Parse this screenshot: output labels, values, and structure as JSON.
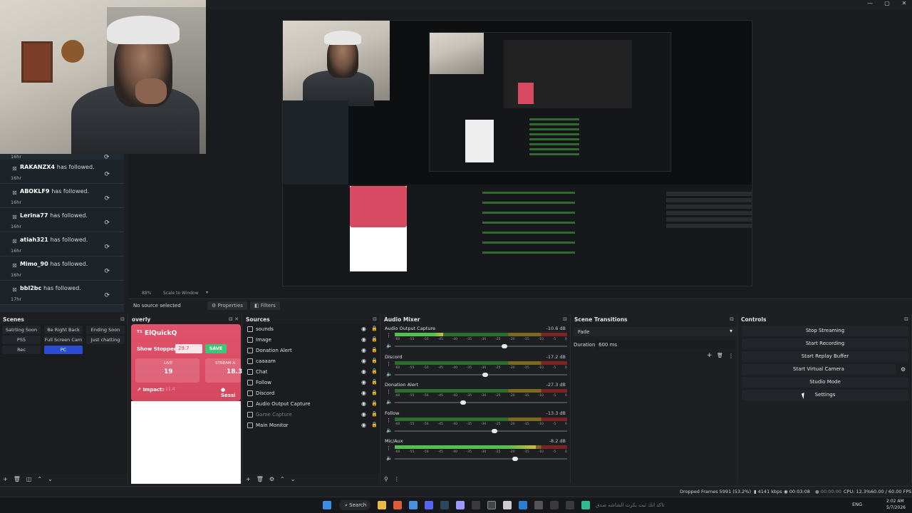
{
  "window": {
    "minimize": "—",
    "maximize": "▢",
    "close": "✕"
  },
  "chat": {
    "top_time": "16hr",
    "items": [
      {
        "name": "RAKANZX4",
        "text": "has followed.",
        "time": "16hr"
      },
      {
        "name": "ABOKLF9",
        "text": "has followed.",
        "time": "16hr"
      },
      {
        "name": "Lerina77",
        "text": "has followed.",
        "time": "16hr"
      },
      {
        "name": "atiah321",
        "text": "has followed.",
        "time": "16hr"
      },
      {
        "name": "Mimo_90",
        "text": "has followed.",
        "time": "16hr"
      },
      {
        "name": "bbl2bc",
        "text": "has followed.",
        "time": "17hr"
      }
    ]
  },
  "preview_toolbar": {
    "zoom": "88%",
    "scale_mode": "Scale to Window"
  },
  "source_bar": {
    "status": "No source selected",
    "properties": "Properties",
    "filters": "Filters"
  },
  "docks": {
    "scenes": {
      "title": "Scenes",
      "items": [
        "Satrting Soon",
        "Be Right Back",
        "Ending Soon",
        "PS5",
        "Full Screen Cam",
        "Just chatting",
        "Rec",
        "PC"
      ],
      "active": "PC"
    },
    "overly": {
      "title": "overly",
      "brand": "ElQuickQ",
      "show_stopper_label": "Show Stopper:",
      "show_stopper_value": "29.7",
      "save": "SAVE",
      "live_label": "LIVE",
      "live_value": "19",
      "stream_label": "STREAM A",
      "stream_value": "18.3",
      "impact_label": "Impact:",
      "impact_value": "-11.4",
      "session_label": "Sessi"
    },
    "sources": {
      "title": "Sources",
      "items": [
        {
          "name": "sounds",
          "dim": false
        },
        {
          "name": "Image",
          "dim": false
        },
        {
          "name": "Donation Alert",
          "dim": false
        },
        {
          "name": "caaaam",
          "dim": false
        },
        {
          "name": "Chat",
          "dim": false
        },
        {
          "name": "Follow",
          "dim": false
        },
        {
          "name": "Discord",
          "dim": false
        },
        {
          "name": "Audio Output Capture",
          "dim": false
        },
        {
          "name": "Game Capture",
          "dim": true
        },
        {
          "name": "Main Monitor",
          "dim": false
        }
      ]
    },
    "mixer": {
      "title": "Audio Mixer",
      "ticks": [
        "-60",
        "-55",
        "-50",
        "-45",
        "-40",
        "-35",
        "-30",
        "-25",
        "-20",
        "-15",
        "-10",
        "-5",
        "0"
      ],
      "channels": [
        {
          "name": "Audio Output Capture",
          "db": "-10.6 dB",
          "level": 0.28,
          "fader": 0.62
        },
        {
          "name": "Discord",
          "db": "-17.2 dB",
          "level": 0.0,
          "fader": 0.51
        },
        {
          "name": "Donation Alert",
          "db": "-27.3 dB",
          "level": 0.0,
          "fader": 0.38
        },
        {
          "name": "Follow",
          "db": "-13.3 dB",
          "level": 0.0,
          "fader": 0.56
        },
        {
          "name": "Mic/Aux",
          "db": "-8.2 dB",
          "level": 0.82,
          "fader": 0.68
        }
      ]
    },
    "transitions": {
      "title": "Scene Transitions",
      "type": "Fade",
      "duration_label": "Duration",
      "duration_value": "600 ms"
    },
    "controls": {
      "title": "Controls",
      "buttons": [
        "Stop Streaming",
        "Start Recording",
        "Start Replay Buffer",
        "Start Virtual Camera",
        "Studio Mode",
        "Settings"
      ]
    }
  },
  "statusbar": {
    "dropped": "Dropped Frames 5991 (53.2%)",
    "kbps": "4141 kbps",
    "stream_time": "00:03:08",
    "rec_time": "00:00:00",
    "cpu": "CPU: 12.3%",
    "fps": "60.00 / 60.00 FPS"
  },
  "taskbar": {
    "search": "Search",
    "notice": "تاكد انك ثبت بكرت الشاشه صدق",
    "lang": "ENG",
    "time": "2:02 AM",
    "date": "5/7/2026"
  }
}
